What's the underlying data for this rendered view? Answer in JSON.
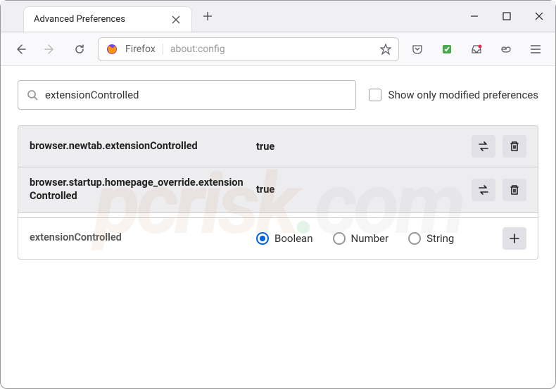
{
  "titlebar": {
    "tab_title": "Advanced Preferences"
  },
  "toolbar": {
    "fox_label": "Firefox",
    "url": "about:config"
  },
  "search": {
    "value": "extensionControlled",
    "checkbox_label": "Show only modified preferences"
  },
  "prefs": {
    "modified": [
      {
        "name": "browser.newtab.extensionControlled",
        "value": "true"
      },
      {
        "name": "browser.startup.homepage_override.extensionControlled",
        "value": "true"
      }
    ],
    "new": {
      "name": "extensionControlled",
      "types": {
        "boolean": "Boolean",
        "number": "Number",
        "string": "String"
      }
    }
  },
  "watermark": {
    "p1": "pcrisk",
    "p2": ".",
    "p3": "com"
  }
}
